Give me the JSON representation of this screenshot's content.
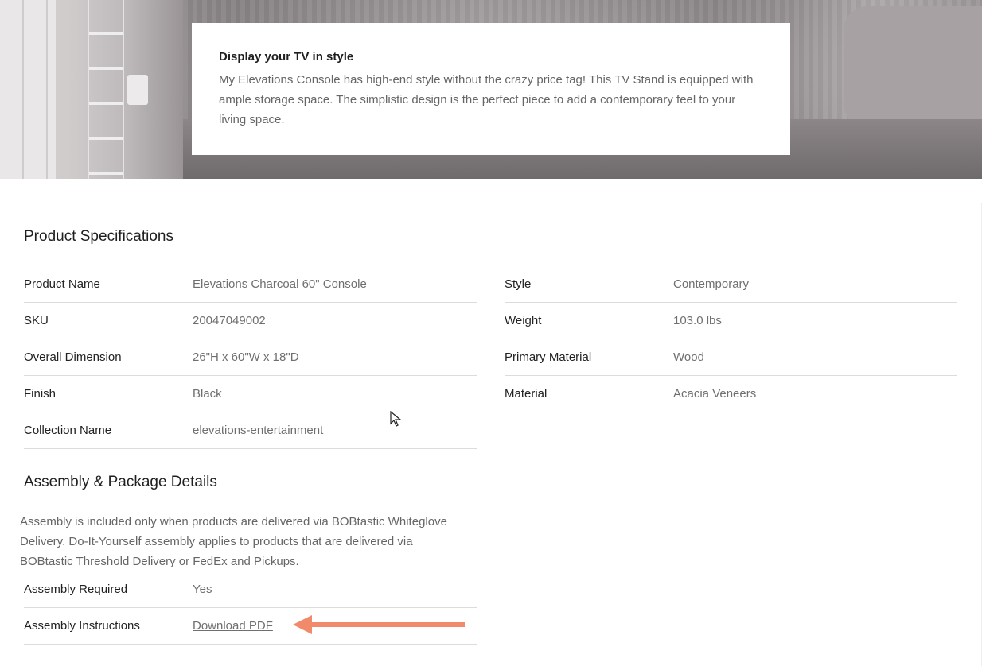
{
  "hero": {
    "title": "Display your TV in style",
    "description": "My Elevations Console has high-end style without the crazy price tag! This TV Stand is equipped with ample storage space. The simplistic design is the perfect piece to add a contemporary feel to your living space."
  },
  "specs": {
    "heading": "Product Specifications",
    "left": [
      {
        "label": "Product Name",
        "value": "Elevations Charcoal 60\" Console"
      },
      {
        "label": "SKU",
        "value": "20047049002"
      },
      {
        "label": "Overall Dimension",
        "value": "26\"H x 60\"W x 18\"D"
      },
      {
        "label": "Finish",
        "value": "Black"
      },
      {
        "label": "Collection Name",
        "value": "elevations-entertainment"
      }
    ],
    "right": [
      {
        "label": "Style",
        "value": "Contemporary"
      },
      {
        "label": "Weight",
        "value": "103.0 lbs"
      },
      {
        "label": "Primary Material",
        "value": "Wood"
      },
      {
        "label": "Material",
        "value": "Acacia Veneers"
      }
    ]
  },
  "assembly": {
    "heading": "Assembly & Package Details",
    "description": "Assembly is included only when products are delivered via BOBtastic Whiteglove Delivery. Do-It-Yourself assembly applies to products that are delivered via BOBtastic Threshold Delivery or FedEx and Pickups.",
    "required_label": "Assembly Required",
    "required_value": "Yes",
    "instructions_label": "Assembly Instructions",
    "instructions_link": "Download PDF"
  },
  "colors": {
    "annotation_arrow": "#f08a6a"
  },
  "icons": {
    "pointer": "mouse-cursor-icon",
    "arrow": "annotation-arrow-icon"
  }
}
